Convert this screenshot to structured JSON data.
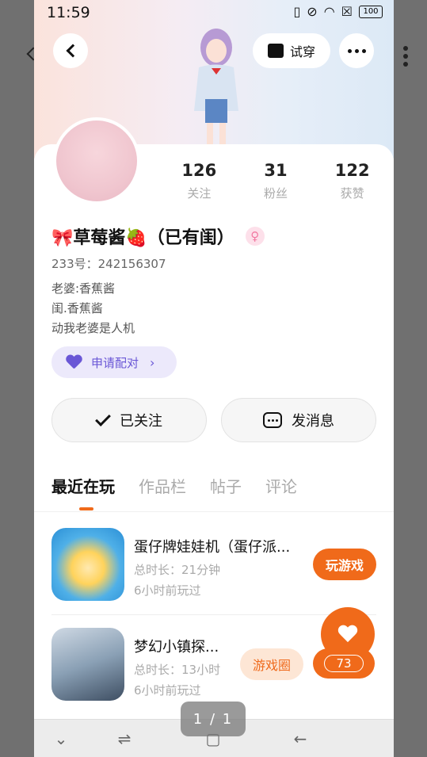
{
  "status_bar": {
    "time": "11:59",
    "battery": "100"
  },
  "header": {
    "try_on_label": "试穿"
  },
  "profile": {
    "stats": [
      {
        "value": "126",
        "label": "关注"
      },
      {
        "value": "31",
        "label": "粉丝"
      },
      {
        "value": "122",
        "label": "获赞"
      }
    ],
    "name": "🎀草莓酱🍓（已有闺）",
    "gender_symbol": "♀",
    "uid": "233号：242156307",
    "bio": [
      "老婆:香蕉酱",
      "闺.香蕉酱",
      "动我老婆是人机"
    ],
    "pair_label": "申请配对",
    "follow_label": "已关注",
    "message_label": "发消息"
  },
  "tabs": [
    "最近在玩",
    "作品栏",
    "帖子",
    "评论"
  ],
  "games": [
    {
      "title": "蛋仔牌娃娃机（蛋仔派...",
      "duration": "总时长：21分钟",
      "last_played": "6小时前玩过",
      "action": "玩游戏"
    },
    {
      "title": "梦幻小镇探...",
      "duration": "总时长：13小时",
      "last_played": "6小时前玩过",
      "action": "游戏圈"
    }
  ],
  "like_count": "73",
  "pager": "1 / 1",
  "colors": {
    "accent": "#f06a1a",
    "pair": "#6a57d6"
  }
}
